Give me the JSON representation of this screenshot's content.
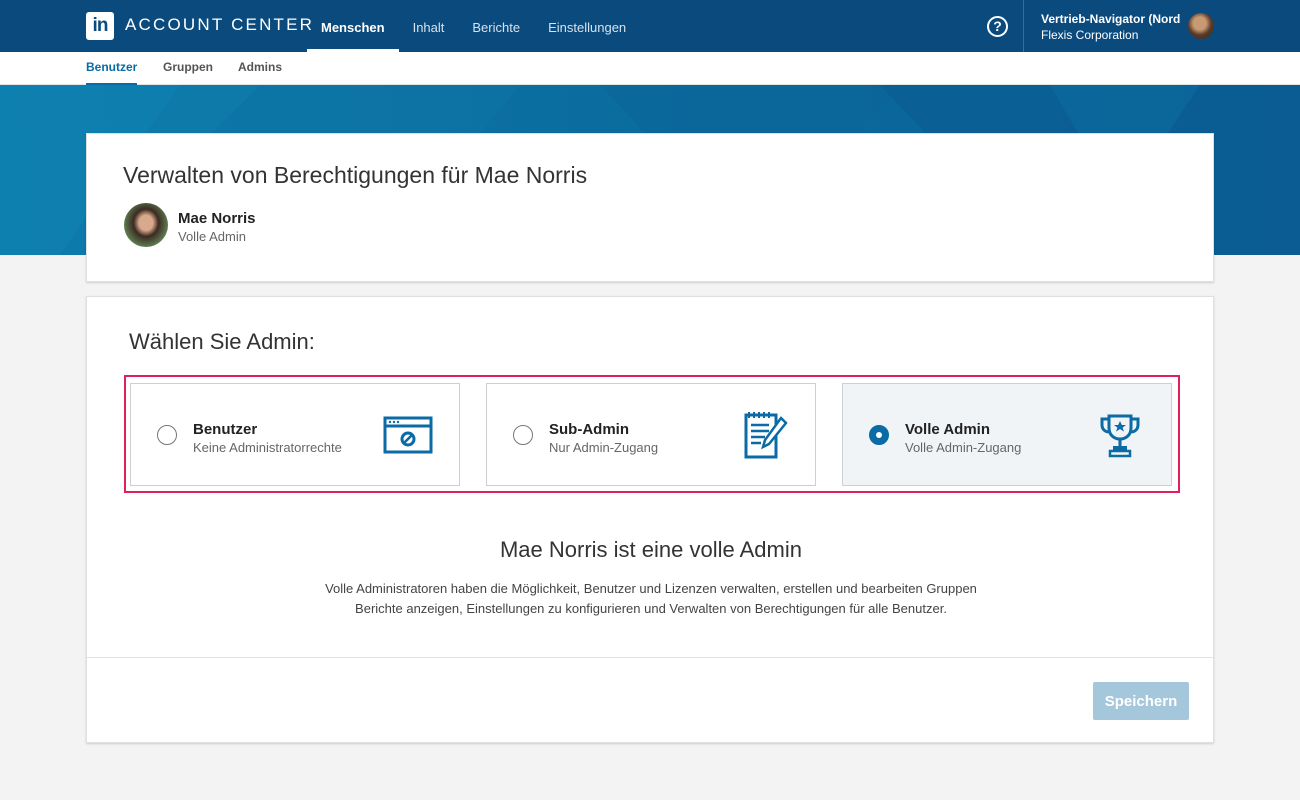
{
  "header": {
    "logo_text": "in",
    "app_title": "ACCOUNT CENTER",
    "nav": [
      {
        "label": "Menschen",
        "active": true
      },
      {
        "label": "Inhalt",
        "active": false
      },
      {
        "label": "Berichte",
        "active": false
      },
      {
        "label": "Einstellungen",
        "active": false
      }
    ],
    "help_icon": "question-circle-icon",
    "help_glyph": "?",
    "account_name": "Vertrieb-Navigator (Nord",
    "account_org": "Flexis Corporation"
  },
  "subnav": {
    "items": [
      {
        "label": "Benutzer",
        "active": true
      },
      {
        "label": "Gruppen",
        "active": false
      },
      {
        "label": "Admins",
        "active": false
      }
    ]
  },
  "profile": {
    "title": "Verwalten von Berechtigungen für Mae Norris",
    "name": "Mae Norris",
    "role": "Volle Admin"
  },
  "admin_select": {
    "title": "Wählen Sie Admin:",
    "options": [
      {
        "title": "Benutzer",
        "desc": "Keine Administratorrechte",
        "icon": "browser-blocked-icon",
        "selected": false
      },
      {
        "title": "Sub-Admin",
        "desc": "Nur Admin-Zugang",
        "icon": "notepad-pencil-icon",
        "selected": false
      },
      {
        "title": "Volle Admin",
        "desc": "Volle Admin-Zugang",
        "icon": "trophy-icon",
        "selected": true
      }
    ]
  },
  "result": {
    "heading": "Mae Norris ist eine volle Admin",
    "desc_line1": "Volle Administratoren haben die Möglichkeit, Benutzer und Lizenzen verwalten, erstellen und bearbeiten Gruppen",
    "desc_line2": "Berichte anzeigen, Einstellungen zu konfigurieren und Verwalten von Berechtigungen für alle Benutzer."
  },
  "actions": {
    "save_label": "Speichern"
  },
  "colors": {
    "topbar": "#0b4a7d",
    "accent": "#0b6ba5",
    "highlight": "#e0205b",
    "save_disabled": "#a5c7dc"
  }
}
